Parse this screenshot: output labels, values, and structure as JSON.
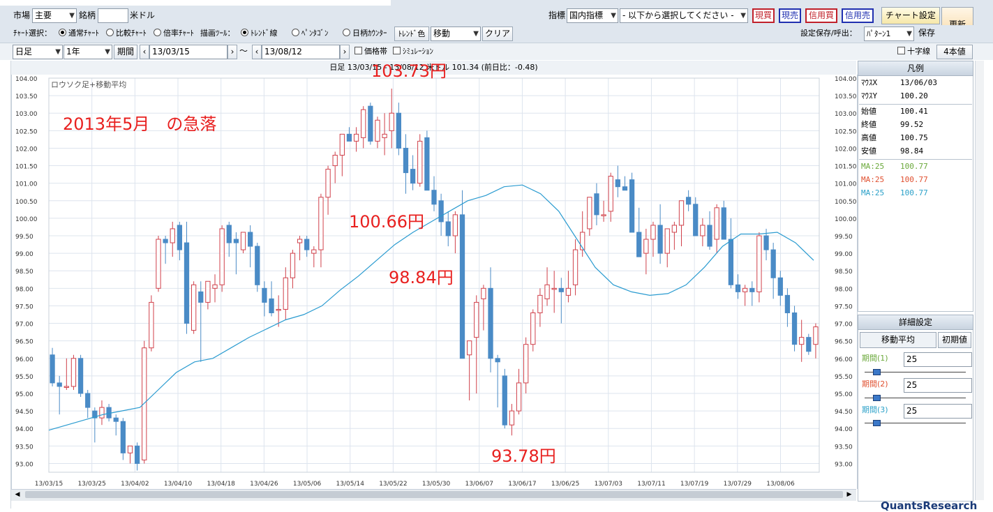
{
  "toolbar": {
    "market_label": "市場",
    "market_value": "主要",
    "symbol_label": "銘柄",
    "symbol_value": "",
    "symbol_name": "米ドル",
    "indicator_label": "指標",
    "indicator_value": "国内指標",
    "indicator_select": "- 以下から選択してください -",
    "btn_genkai": "現買",
    "btn_genbai": "現売",
    "btn_shinyo_kai": "信用買",
    "btn_shinyo_bai": "信用売",
    "chart_settings": "チャート設定",
    "update": "更新",
    "chart_select_label": "ﾁｬｰﾄ選択：",
    "radio_normal": "通常ﾁｬｰﾄ",
    "radio_compare": "比較ﾁｬｰﾄ",
    "radio_ratio": "倍率ﾁｬｰﾄ",
    "draw_tool_label": "描画ﾂｰﾙ：",
    "radio_trend": "ﾄﾚﾝﾄﾞ線",
    "radio_pentagon": "ﾍﾟﾝﾀｺﾞﾝ",
    "radio_counter": "日柄ｶｳﾝﾀｰ",
    "trend_color": "ﾄﾚﾝﾄﾞ色",
    "move_value": "移動",
    "clear": "クリア",
    "save_label": "設定保存/呼出：",
    "pattern_value": "ﾊﾟﾀｰﾝ1",
    "save": "保存",
    "period_type": "日足",
    "range": "1年",
    "period_btn": "期間",
    "date_from": "13/03/15",
    "tilde": "～",
    "date_to": "13/08/12",
    "price_band": "価格帯",
    "simulation": "ｼﾐｭﾚｰｼｮﾝ",
    "crosshair": "十字線",
    "four_values": "4本値"
  },
  "chart_header": "日足 13/03/15 - 13/08/12 米ドル 101.34 (前日比：-0.48)",
  "chart_corner_label": "ロウソク足+移動平均",
  "annotations": {
    "title": "2013年5月　の急落",
    "a1": "103.73円",
    "a2": "100.66円",
    "a3": "98.84円",
    "a4": "93.78円"
  },
  "legend": {
    "title": "凡例",
    "mouse_x_label": "ﾏｳｽX",
    "mouse_x_value": "13/06/03",
    "mouse_y_label": "ﾏｳｽY",
    "mouse_y_value": "100.20",
    "open_label": "始値",
    "open_value": "100.41",
    "close_label": "終値",
    "close_value": "99.52",
    "high_label": "高値",
    "high_value": "100.75",
    "low_label": "安値",
    "low_value": "98.84",
    "ma1_label": "MA:25",
    "ma1_value": "100.77",
    "ma2_label": "MA:25",
    "ma2_value": "100.77",
    "ma3_label": "MA:25",
    "ma3_value": "100.77"
  },
  "detail": {
    "title": "詳細設定",
    "tab_ma": "移動平均",
    "tab_init": "初期値",
    "p1_label": "期間(1)",
    "p1_value": "25",
    "p2_label": "期間(2)",
    "p2_value": "25",
    "p3_label": "期間(3)",
    "p3_value": "25"
  },
  "footer_brand": "QuantsResearch",
  "colors": {
    "up": "#d0404a",
    "down": "#4a8bc6",
    "ma": "#2a9bd0",
    "annotation": "#e8201f",
    "ma1": "#6aa83a",
    "ma2": "#e05030",
    "ma3": "#2aa0c8"
  },
  "chart_data": {
    "type": "candlestick",
    "title": "",
    "ylim": [
      92.75,
      104.0
    ],
    "y_ticks": [
      "104.00",
      "103.50",
      "103.00",
      "102.50",
      "102.00",
      "101.50",
      "101.00",
      "100.50",
      "100.00",
      "99.50",
      "99.00",
      "98.50",
      "98.00",
      "97.50",
      "97.00",
      "96.50",
      "96.00",
      "95.50",
      "95.00",
      "94.50",
      "94.00",
      "93.50",
      "93.00"
    ],
    "x_tick_labels": [
      "13/03/15",
      "13/03/25",
      "13/04/02",
      "13/04/10",
      "13/04/18",
      "13/04/26",
      "13/05/06",
      "13/05/14",
      "13/05/22",
      "13/05/30",
      "13/06/07",
      "13/06/17",
      "13/06/25",
      "13/07/03",
      "13/07/11",
      "13/07/19",
      "13/07/29",
      "13/08/06"
    ],
    "ohlc": [
      [
        96.1,
        96.3,
        95.2,
        95.3
      ],
      [
        95.3,
        95.5,
        94.4,
        95.2
      ],
      [
        95.2,
        96.0,
        95.1,
        95.2
      ],
      [
        95.2,
        96.1,
        95.1,
        96.0
      ],
      [
        96.0,
        96.1,
        94.9,
        95.0
      ],
      [
        95.0,
        95.1,
        94.3,
        94.6
      ],
      [
        94.5,
        94.6,
        93.6,
        94.3
      ],
      [
        94.3,
        94.8,
        94.1,
        94.6
      ],
      [
        94.6,
        94.7,
        94.2,
        94.3
      ],
      [
        94.3,
        94.4,
        93.8,
        94.2
      ],
      [
        94.2,
        94.3,
        93.1,
        93.3
      ],
      [
        93.3,
        93.5,
        93.0,
        93.5
      ],
      [
        93.5,
        93.6,
        92.8,
        93.0
      ],
      [
        93.1,
        96.5,
        93.0,
        96.3
      ],
      [
        96.3,
        97.8,
        96.2,
        97.6
      ],
      [
        98.0,
        99.5,
        97.9,
        99.4
      ],
      [
        99.4,
        99.5,
        98.7,
        99.3
      ],
      [
        99.3,
        99.9,
        98.9,
        99.7
      ],
      [
        99.8,
        99.9,
        98.8,
        99.1
      ],
      [
        99.3,
        99.9,
        96.7,
        97.0
      ],
      [
        96.8,
        98.2,
        96.7,
        98.1
      ],
      [
        97.9,
        98.2,
        95.9,
        97.6
      ],
      [
        97.6,
        98.1,
        97.4,
        98.2
      ],
      [
        98.0,
        98.4,
        97.6,
        98.1
      ],
      [
        98.1,
        99.8,
        97.9,
        99.7
      ],
      [
        99.8,
        99.9,
        98.9,
        99.3
      ],
      [
        99.4,
        99.6,
        98.4,
        99.3
      ],
      [
        99.1,
        99.6,
        99.0,
        99.6
      ],
      [
        99.6,
        99.8,
        98.6,
        99.2
      ],
      [
        99.2,
        99.3,
        97.9,
        98.1
      ],
      [
        98.0,
        98.2,
        97.2,
        97.6
      ],
      [
        97.7,
        98.2,
        97.2,
        97.3
      ],
      [
        97.4,
        97.8,
        96.9,
        97.4
      ],
      [
        97.4,
        98.6,
        97.1,
        98.3
      ],
      [
        98.3,
        99.1,
        98.0,
        99.0
      ],
      [
        99.3,
        99.5,
        98.8,
        99.4
      ],
      [
        99.4,
        99.5,
        98.9,
        99.1
      ],
      [
        99.0,
        99.2,
        98.6,
        99.1
      ],
      [
        99.1,
        100.7,
        98.6,
        100.6
      ],
      [
        100.6,
        101.5,
        100.1,
        101.4
      ],
      [
        101.5,
        101.9,
        101.0,
        101.8
      ],
      [
        101.8,
        102.3,
        101.2,
        102.4
      ],
      [
        102.4,
        102.6,
        102.3,
        102.2
      ],
      [
        102.2,
        102.6,
        101.9,
        102.4
      ],
      [
        102.3,
        103.2,
        102.0,
        103.1
      ],
      [
        103.2,
        103.3,
        102.1,
        102.2
      ],
      [
        102.2,
        102.9,
        102.0,
        102.8
      ],
      [
        102.3,
        103.0,
        101.8,
        102.4
      ],
      [
        102.5,
        103.7,
        102.0,
        103.0
      ],
      [
        103.0,
        103.3,
        101.8,
        102.0
      ],
      [
        102.0,
        102.4,
        100.7,
        101.3
      ],
      [
        101.4,
        101.8,
        100.8,
        101.0
      ],
      [
        101.0,
        102.4,
        100.9,
        102.2
      ],
      [
        102.3,
        102.5,
        100.8,
        100.8
      ],
      [
        100.8,
        101.2,
        100.2,
        100.4
      ],
      [
        100.5,
        100.7,
        99.5,
        99.9
      ],
      [
        99.9,
        100.2,
        99.2,
        99.5
      ],
      [
        99.5,
        100.2,
        99.0,
        100.1
      ],
      [
        100.1,
        100.8,
        98.8,
        96.0
      ],
      [
        96.1,
        96.4,
        94.8,
        96.5
      ],
      [
        96.6,
        97.8,
        95.0,
        97.6
      ],
      [
        97.7,
        98.1,
        96.8,
        98.0
      ],
      [
        98.0,
        98.6,
        95.6,
        96.0
      ],
      [
        96.0,
        96.1,
        94.6,
        95.9
      ],
      [
        95.5,
        95.7,
        94.0,
        94.1
      ],
      [
        94.1,
        94.7,
        93.8,
        94.5
      ],
      [
        94.5,
        95.7,
        94.4,
        95.3
      ],
      [
        95.3,
        96.6,
        95.0,
        96.4
      ],
      [
        96.4,
        97.4,
        96.2,
        97.3
      ],
      [
        97.3,
        98.0,
        96.9,
        97.8
      ],
      [
        97.7,
        98.6,
        97.5,
        98.1
      ],
      [
        98.0,
        98.5,
        97.3,
        98.0
      ],
      [
        98.0,
        98.3,
        97.0,
        97.9
      ],
      [
        97.8,
        98.5,
        97.6,
        98.0
      ],
      [
        98.1,
        99.4,
        97.8,
        99.1
      ],
      [
        99.1,
        100.2,
        98.9,
        99.6
      ],
      [
        99.7,
        100.6,
        99.5,
        100.6
      ],
      [
        100.7,
        101.0,
        99.8,
        100.1
      ],
      [
        100.1,
        100.5,
        99.9,
        100.1
      ],
      [
        100.2,
        101.3,
        99.9,
        101.2
      ],
      [
        101.1,
        101.5,
        100.6,
        100.9
      ],
      [
        100.9,
        101.2,
        100.8,
        100.8
      ],
      [
        101.1,
        101.3,
        99.9,
        99.6
      ],
      [
        99.6,
        100.3,
        99.0,
        98.9
      ],
      [
        99.0,
        99.7,
        98.4,
        99.4
      ],
      [
        99.4,
        99.9,
        98.9,
        99.8
      ],
      [
        99.8,
        100.4,
        98.7,
        99.0
      ],
      [
        99.0,
        99.3,
        98.6,
        99.7
      ],
      [
        99.6,
        99.9,
        99.1,
        99.8
      ],
      [
        99.8,
        100.5,
        99.2,
        100.5
      ],
      [
        100.6,
        100.8,
        100.2,
        100.4
      ],
      [
        100.4,
        100.6,
        99.6,
        99.5
      ],
      [
        99.5,
        100.0,
        99.2,
        99.8
      ],
      [
        99.8,
        100.2,
        99.1,
        99.2
      ],
      [
        99.4,
        100.4,
        99.0,
        100.3
      ],
      [
        100.3,
        100.5,
        99.4,
        99.4
      ],
      [
        99.4,
        100.0,
        98.0,
        98.1
      ],
      [
        98.1,
        98.4,
        97.7,
        97.9
      ],
      [
        97.9,
        98.1,
        97.5,
        98.0
      ],
      [
        98.0,
        98.2,
        97.5,
        97.9
      ],
      [
        97.9,
        99.6,
        97.6,
        99.5
      ],
      [
        99.5,
        99.7,
        98.8,
        99.1
      ],
      [
        99.1,
        99.3,
        97.7,
        98.3
      ],
      [
        98.3,
        98.5,
        97.5,
        97.8
      ],
      [
        97.8,
        98.0,
        96.9,
        97.3
      ],
      [
        97.3,
        97.5,
        96.2,
        96.4
      ],
      [
        96.4,
        97.1,
        95.9,
        96.6
      ],
      [
        96.6,
        96.7,
        96.1,
        96.2
      ],
      [
        96.4,
        97.0,
        96.0,
        96.9
      ]
    ],
    "ma25": [
      93.95,
      94.1,
      94.25,
      94.4,
      94.5,
      94.6,
      95.1,
      95.6,
      95.9,
      96.0,
      96.3,
      96.6,
      96.85,
      97.1,
      97.25,
      97.5,
      97.95,
      98.35,
      98.8,
      99.25,
      99.6,
      99.9,
      100.2,
      100.5,
      100.65,
      100.9,
      100.95,
      100.7,
      100.2,
      99.4,
      98.6,
      98.1,
      97.9,
      97.8,
      97.85,
      98.1,
      98.6,
      99.2,
      99.55,
      99.55,
      99.6,
      99.3,
      98.8
    ]
  }
}
